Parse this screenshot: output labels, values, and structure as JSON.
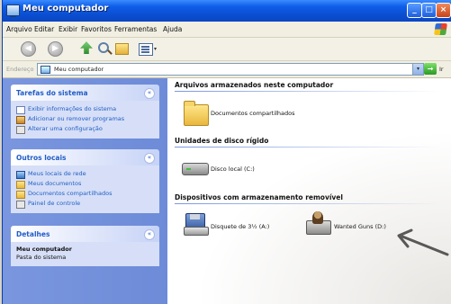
{
  "window": {
    "title": "Meu computador"
  },
  "title_buttons": {
    "min": "_",
    "max": "□",
    "close": "×"
  },
  "menu": [
    "Arquivo",
    "Editar",
    "Exibir",
    "Favoritos",
    "Ferramentas",
    "Ajuda"
  ],
  "toolbar": {
    "back_glyph": "◀",
    "forward_glyph": "▶",
    "views_arrow": "▾"
  },
  "address": {
    "label": "Endereço",
    "value": "Meu computador",
    "go": "Ir",
    "go_glyph": "→",
    "dropdown_glyph": "▾"
  },
  "sidebar": {
    "chevron": "«",
    "tasks": {
      "title": "Tarefas do sistema",
      "items": [
        "Exibir informações do sistema",
        "Adicionar ou remover programas",
        "Alterar uma configuração"
      ]
    },
    "other": {
      "title": "Outros locais",
      "items": [
        "Meus locais de rede",
        "Meus documentos",
        "Documentos compartilhados",
        "Painel de controle"
      ]
    },
    "details": {
      "title": "Detalhes",
      "name": "Meu computador",
      "desc": "Pasta do sistema"
    }
  },
  "content": {
    "stored": {
      "title": "Arquivos armazenados neste computador",
      "items": [
        "Documentos compartilhados"
      ]
    },
    "hard": {
      "title": "Unidades de disco rígido",
      "items": [
        "Disco local (C:)"
      ]
    },
    "removable": {
      "title": "Dispositivos com armazenamento removível",
      "items": [
        "Disquete de 3½ (A:)",
        "Wanted Guns (D:)"
      ]
    }
  },
  "colors": {
    "titlebar": "#0a4ed0",
    "sidebar": "#7a96df",
    "link": "#215dc6",
    "arrow": "#555555"
  }
}
